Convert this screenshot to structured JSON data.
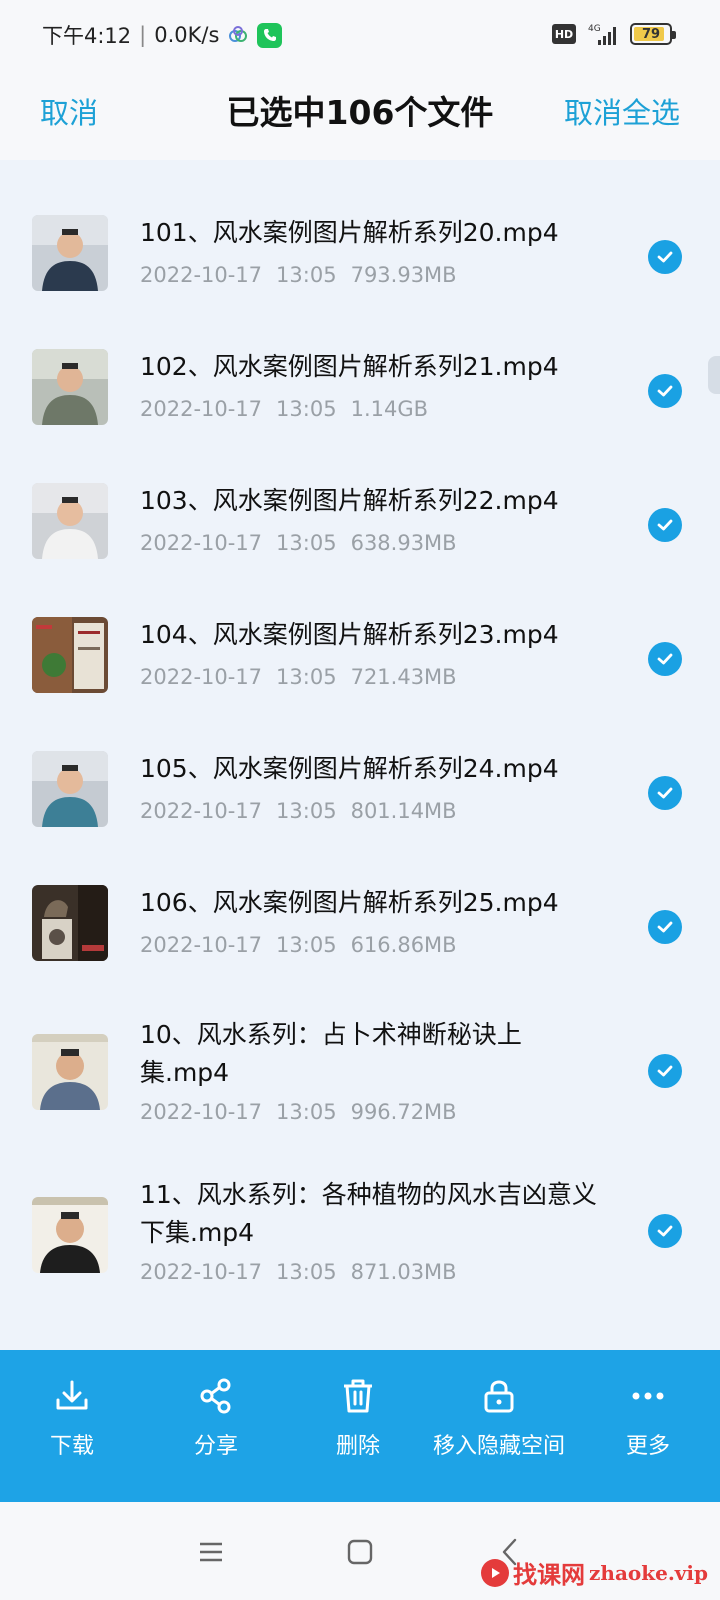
{
  "status": {
    "time": "下午4:12",
    "speed": "0.0K/s",
    "hd": "HD",
    "network": "4G",
    "battery": "79",
    "icons": [
      "cloud-sync-icon",
      "phone-call-icon",
      "signal-icon",
      "battery-icon"
    ]
  },
  "header": {
    "cancel": "取消",
    "title": "已选中106个文件",
    "deselect_all": "取消全选"
  },
  "files": [
    {
      "name": "101、风水案例图片解析系列20.mp4",
      "date": "2022-10-17",
      "time": "13:05",
      "size": "793.93MB",
      "selected": true
    },
    {
      "name": "102、风水案例图片解析系列21.mp4",
      "date": "2022-10-17",
      "time": "13:05",
      "size": "1.14GB",
      "selected": true
    },
    {
      "name": "103、风水案例图片解析系列22.mp4",
      "date": "2022-10-17",
      "time": "13:05",
      "size": "638.93MB",
      "selected": true
    },
    {
      "name": "104、风水案例图片解析系列23.mp4",
      "date": "2022-10-17",
      "time": "13:05",
      "size": "721.43MB",
      "selected": true
    },
    {
      "name": "105、风水案例图片解析系列24.mp4",
      "date": "2022-10-17",
      "time": "13:05",
      "size": "801.14MB",
      "selected": true
    },
    {
      "name": "106、风水案例图片解析系列25.mp4",
      "date": "2022-10-17",
      "time": "13:05",
      "size": "616.86MB",
      "selected": true
    },
    {
      "name": "10、风水系列：占卜术神断秘诀上集.mp4",
      "date": "2022-10-17",
      "time": "13:05",
      "size": "996.72MB",
      "selected": true
    },
    {
      "name": "11、风水系列：各种植物的风水吉凶意义下集.mp4",
      "date": "2022-10-17",
      "time": "13:05",
      "size": "871.03MB",
      "selected": true
    }
  ],
  "toolbar": {
    "download": "下载",
    "share": "分享",
    "delete": "删除",
    "hide": "移入隐藏空间",
    "more": "更多"
  },
  "watermark": {
    "cn": "找课网",
    "en": "zhaoke.vip"
  },
  "colors": {
    "accent": "#1da1d6",
    "toolbar": "#1ea3e6",
    "check": "#1aa1e3"
  }
}
